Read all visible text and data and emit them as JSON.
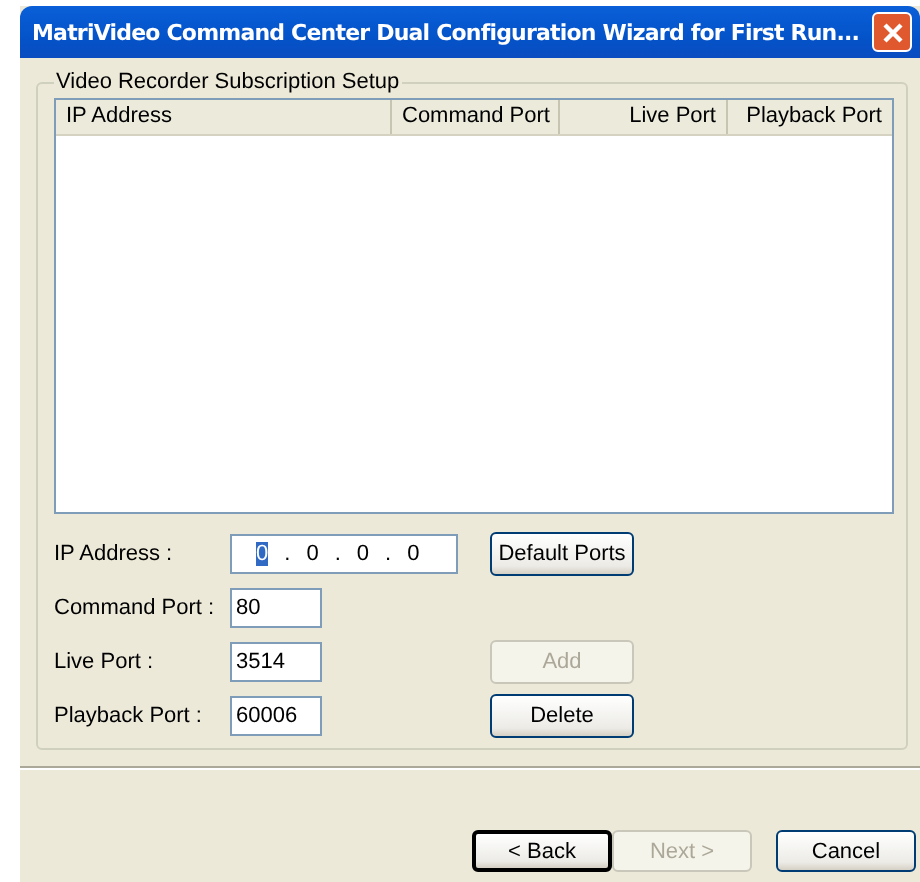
{
  "window": {
    "title": "MatriVideo Command Center Dual Configuration Wizard for First Run..."
  },
  "group": {
    "title": "Video Recorder Subscription Setup"
  },
  "table": {
    "columns": [
      {
        "label": "IP Address"
      },
      {
        "label": "Command Port"
      },
      {
        "label": "Live Port"
      },
      {
        "label": "Playback Port"
      }
    ]
  },
  "form": {
    "ip_label": "IP Address :",
    "ip_octets": [
      {
        "value": "0",
        "selected": true
      },
      {
        "value": "0",
        "selected": false
      },
      {
        "value": "0",
        "selected": false
      },
      {
        "value": "0",
        "selected": false
      }
    ],
    "ip_separator": ".",
    "fields": [
      {
        "label": "Command Port :",
        "value": "80"
      },
      {
        "label": "Live Port :",
        "value": "3514"
      },
      {
        "label": "Playback Port :",
        "value": "60006"
      }
    ],
    "side_buttons": [
      {
        "label": "Default Ports",
        "disabled": false
      },
      {
        "label": "Add",
        "disabled": true
      },
      {
        "label": "Delete",
        "disabled": false
      }
    ]
  },
  "buttons": [
    {
      "label": "< Back",
      "disabled": false,
      "default": true
    },
    {
      "label": "Next >",
      "disabled": true,
      "default": false
    },
    {
      "label": "Cancel",
      "disabled": false,
      "default": false
    }
  ]
}
